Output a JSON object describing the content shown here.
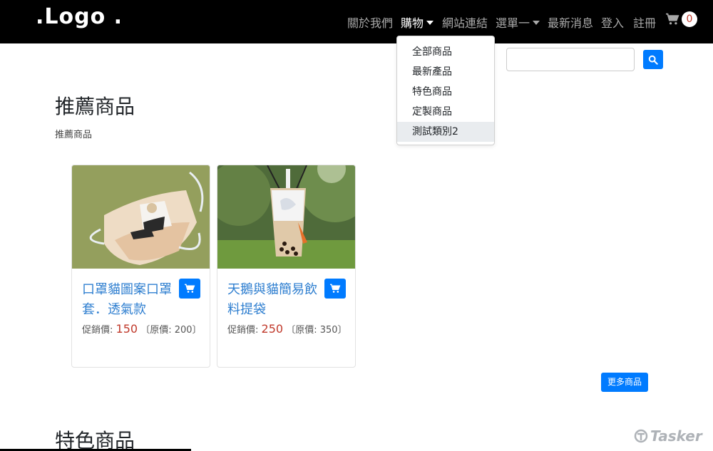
{
  "navbar": {
    "logo": ".Logo .",
    "items": [
      {
        "label": "關於我們"
      },
      {
        "label": "購物"
      },
      {
        "label": "網站連結"
      },
      {
        "label": "選單一"
      },
      {
        "label": "最新消息"
      },
      {
        "label": "登入"
      },
      {
        "label": "註冊"
      }
    ],
    "cart_icon": "cart-icon",
    "cart_count": "0"
  },
  "search": {
    "label": ":",
    "value": "",
    "button_icon": "search-icon"
  },
  "dropdown": {
    "items": [
      {
        "label": "全部商品"
      },
      {
        "label": "最新產品"
      },
      {
        "label": "特色商品"
      },
      {
        "label": "定製商品"
      },
      {
        "label": "測試類別2"
      }
    ]
  },
  "recommended": {
    "title": "推薦商品",
    "subtitle": "推薦商品",
    "products": [
      {
        "name": "口罩貓圖案口罩套．透氣款",
        "promo_label": "促銷價:",
        "promo_price": "150",
        "orig_label": "〔原價:",
        "orig_price": "200",
        "orig_close": "〕"
      },
      {
        "name": "天鵝與貓簡易飲料提袋",
        "promo_label": "促銷價:",
        "promo_price": "250",
        "orig_label": "〔原價:",
        "orig_price": "350",
        "orig_close": "〕"
      }
    ],
    "more_label": "更多商品"
  },
  "featured": {
    "title": "特色商品"
  },
  "watermark": "Tasker",
  "colors": {
    "accent": "#007bff",
    "navbar_bg": "#000000",
    "price": "#c0392b",
    "link": "#2f7fd0"
  }
}
